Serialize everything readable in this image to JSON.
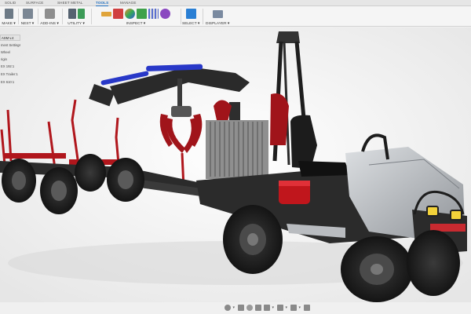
{
  "tabs": [
    {
      "label": "SOLID",
      "active": false
    },
    {
      "label": "SURFACE",
      "active": false
    },
    {
      "label": "SHEET METAL",
      "active": false
    },
    {
      "label": "TOOLS",
      "active": true
    },
    {
      "label": "MANAGE",
      "active": false
    }
  ],
  "ribbon": {
    "make": "MAKE ▾",
    "nest": "NEST ▾",
    "addins": "ADD-INS ▾",
    "utility": "UTILITY ▾",
    "inspect": "INSPECT ▾",
    "select": "SELECT ▾",
    "display": "DISPLAYER ▾"
  },
  "browser": {
    "items": [
      "ASM v.4",
      "ment Settings",
      "Wheel",
      "rigin",
      "EX 192:1",
      "EX Trailer:1",
      "EX 610:1"
    ]
  },
  "colors": {
    "accent": "#1f6fc0",
    "frame_red": "#a0141a",
    "crane_blue": "#2838c8",
    "chassis": "#2b2b2b",
    "body_silver": "#b9bcc0"
  }
}
